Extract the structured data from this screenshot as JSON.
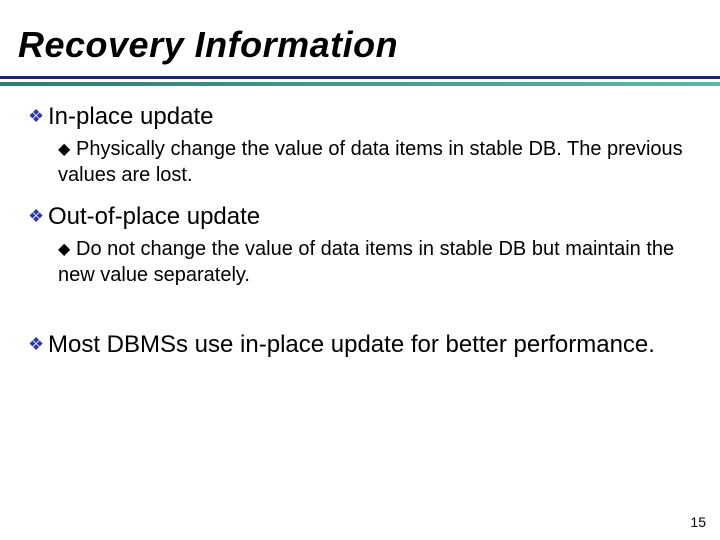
{
  "title": "Recovery Information",
  "items": [
    {
      "heading": "In-place update",
      "sub": "Physically change the value of data items in stable DB. The previous values are lost."
    },
    {
      "heading": "Out-of-place update",
      "sub": "Do not change the value of data items in stable DB but maintain the new value separately."
    },
    {
      "heading": "Most DBMSs use in-place update for better performance.",
      "sub": null
    }
  ],
  "page_number": "15",
  "bullets": {
    "l1": "❖",
    "l2": "◆"
  }
}
